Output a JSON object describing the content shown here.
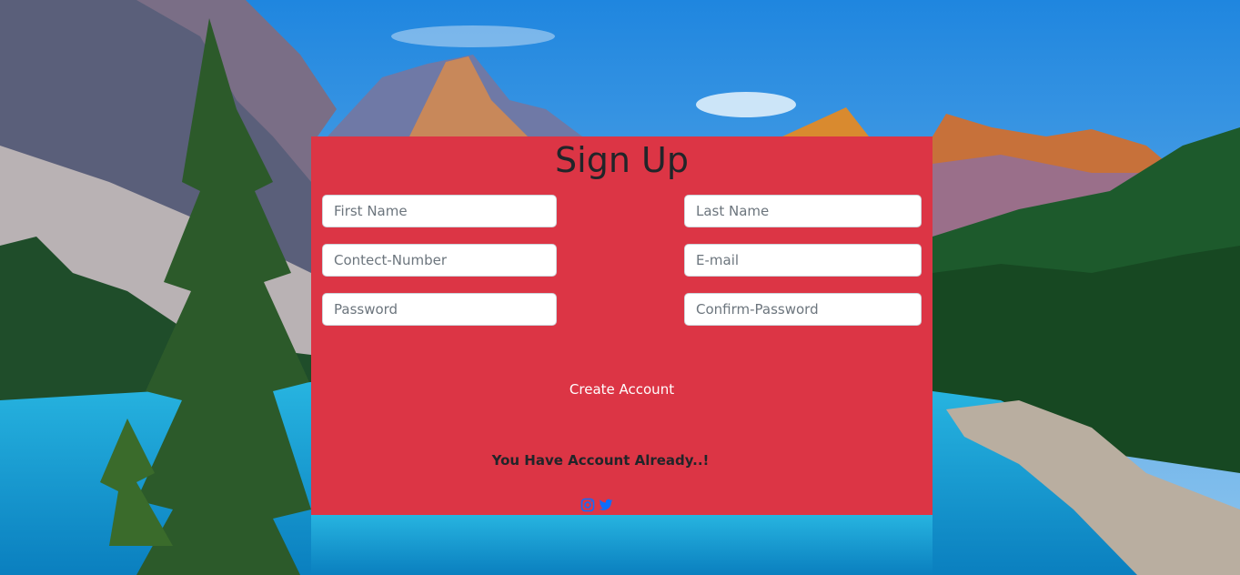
{
  "form": {
    "title": "Sign Up",
    "fields": {
      "first_name": {
        "placeholder": "First Name",
        "value": ""
      },
      "last_name": {
        "placeholder": "Last Name",
        "value": ""
      },
      "contact_number": {
        "placeholder": "Contect-Number",
        "value": ""
      },
      "email": {
        "placeholder": "E-mail",
        "value": ""
      },
      "password": {
        "placeholder": "Password",
        "value": ""
      },
      "confirm_password": {
        "placeholder": "Confirm-Password",
        "value": ""
      }
    },
    "submit_label": "Create Account",
    "login_link_label": "You Have Account Already..!"
  },
  "social": {
    "icons": [
      "instagram-icon",
      "twitter-icon"
    ]
  },
  "colors": {
    "card_background": "#dc3545",
    "title_text": "#212529",
    "button_text": "#ffffff",
    "social_icon": "#0d6efd"
  }
}
